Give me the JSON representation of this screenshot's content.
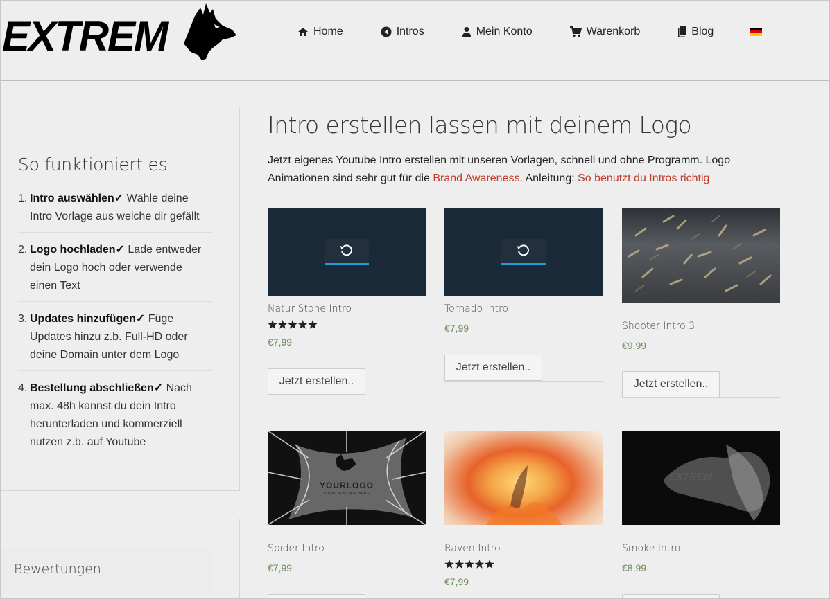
{
  "brand": {
    "logo_text": "EXTREM"
  },
  "nav": {
    "items": [
      {
        "label": "Home",
        "icon": "home-icon"
      },
      {
        "label": "Intros",
        "icon": "play-circle-icon"
      },
      {
        "label": "Mein Konto",
        "icon": "user-icon"
      },
      {
        "label": "Warenkorb",
        "icon": "cart-icon"
      },
      {
        "label": "Blog",
        "icon": "book-icon"
      }
    ],
    "language_flag": "german-flag-icon"
  },
  "sidebar": {
    "title": "So funktioniert es",
    "steps": [
      {
        "num": "1.",
        "bold": "Intro auswählen✓",
        "text": " Wähle deine Intro Vorlage aus welche dir gefällt"
      },
      {
        "num": "2.",
        "bold": "Logo hochladen✓",
        "text": " Lade entweder dein Logo hoch oder verwende einen Text"
      },
      {
        "num": "3.",
        "bold": "Updates hinzufügen✓",
        "text": " Füge Updates hinzu z.b. Full-HD oder deine Domain unter dem Logo"
      },
      {
        "num": "4.",
        "bold": "Bestellung abschließen✓",
        "text": " Nach max. 48h kannst du dein Intro herunterladen und kommerziell nutzen z.b. auf Youtube"
      }
    ],
    "ratings_title": "Bewertungen"
  },
  "main": {
    "title": "Intro erstellen lassen mit deinem Logo",
    "intro_text_1": "Jetzt eigenes Youtube Intro erstellen mit unseren Vorlagen, schnell und ohne Programm. Logo Animationen sind sehr gut für die ",
    "intro_link_1": "Brand Awareness",
    "intro_text_2": ". Anleitung: ",
    "intro_link_2": "So benutzt du Intros richtig"
  },
  "products": [
    {
      "name": "Natur Stone Intro",
      "price": "€7,99",
      "rating": 5,
      "button": "Jetzt erstellen.."
    },
    {
      "name": "Tornado Intro",
      "price": "€7,99",
      "button": "Jetzt erstellen.."
    },
    {
      "name": "Shooter Intro 3",
      "price": "€9,99",
      "button": "Jetzt erstellen.."
    },
    {
      "name": "Spider Intro",
      "price": "€7,99"
    },
    {
      "name": "Raven Intro",
      "price": "€7,99",
      "rating": 5
    },
    {
      "name": "Smoke Intro",
      "price": "€8,99"
    }
  ],
  "thumb_text": {
    "yourlogo": "YOURLOGO",
    "yourlogo_sub": "YOUR SLOGAN HERE",
    "smoke_logo": "EXTREM"
  },
  "colors": {
    "accent_link": "#c0392b",
    "price": "#6d8c5a",
    "video_bg": "#1b2a39",
    "progress": "#1ea0d8"
  }
}
